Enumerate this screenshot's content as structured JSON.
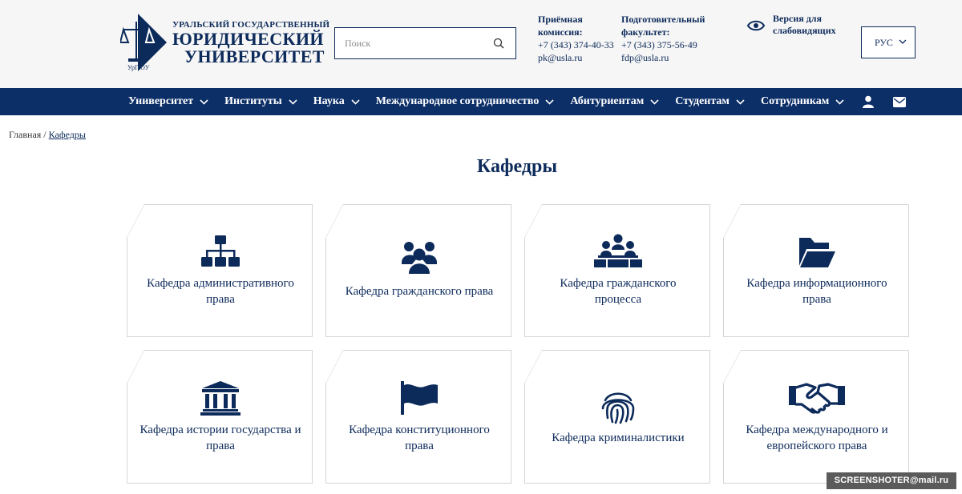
{
  "header": {
    "logo": {
      "line1": "УРАЛЬСКИЙ ГОСУДАРСТВЕННЫЙ",
      "line2": "ЮРИДИЧЕСКИЙ",
      "line3": "УНИВЕРСИТЕТ",
      "emblem_text": "УрГЮУ"
    },
    "search": {
      "placeholder": "Поиск",
      "value": "",
      "icon": "search-icon"
    },
    "contacts": [
      {
        "title1": "Приёмная",
        "title2": "комиссия:",
        "phone": "+7 (343) 374-40-33",
        "email": "pk@usla.ru"
      },
      {
        "title1": "Подготовительный",
        "title2": "факультет:",
        "phone": "+7 (343) 375-56-49",
        "email": "fdp@usla.ru"
      }
    ],
    "vision": {
      "line1": "Версия для",
      "line2": "слабовидящих",
      "icon": "eye-icon"
    },
    "language": {
      "selected": "РУС",
      "icon": "chevron-down-icon"
    }
  },
  "nav": {
    "items": [
      {
        "label": "Университет"
      },
      {
        "label": "Институты"
      },
      {
        "label": "Наука"
      },
      {
        "label": "Международное сотрудничество"
      },
      {
        "label": "Абитуриентам"
      },
      {
        "label": "Студентам"
      },
      {
        "label": "Сотрудникам"
      }
    ],
    "user_icon": "user-icon",
    "mail_icon": "envelope-icon"
  },
  "breadcrumb": {
    "home": "Главная",
    "separator": " / ",
    "current": "Кафедры"
  },
  "page": {
    "title": "Кафедры"
  },
  "cards": [
    {
      "line1": "Кафедра административного",
      "line2": "права",
      "icon": "org-chart-icon"
    },
    {
      "line1": "Кафедра гражданского права",
      "line2": "",
      "icon": "users-group-icon"
    },
    {
      "line1": "Кафедра гражданского",
      "line2": "процесса",
      "icon": "court-hearing-icon"
    },
    {
      "line1": "Кафедра информационного",
      "line2": "права",
      "icon": "folder-open-icon"
    },
    {
      "line1": "Кафедра истории государства и",
      "line2": "права",
      "icon": "institution-icon"
    },
    {
      "line1": "Кафедра конституционного",
      "line2": "права",
      "icon": "flag-icon"
    },
    {
      "line1": "Кафедра криминалистики",
      "line2": "",
      "icon": "fingerprint-icon"
    },
    {
      "line1": "Кафедра международного и",
      "line2": "европейского права",
      "icon": "handshake-icon"
    }
  ],
  "watermark": {
    "text": "SCREENSHOTER@mail.ru"
  },
  "colors": {
    "brand": "#0c2f68",
    "text": "#0c2a5a",
    "header_bg": "#f6f6f6",
    "card_border": "#d6d6d6"
  }
}
